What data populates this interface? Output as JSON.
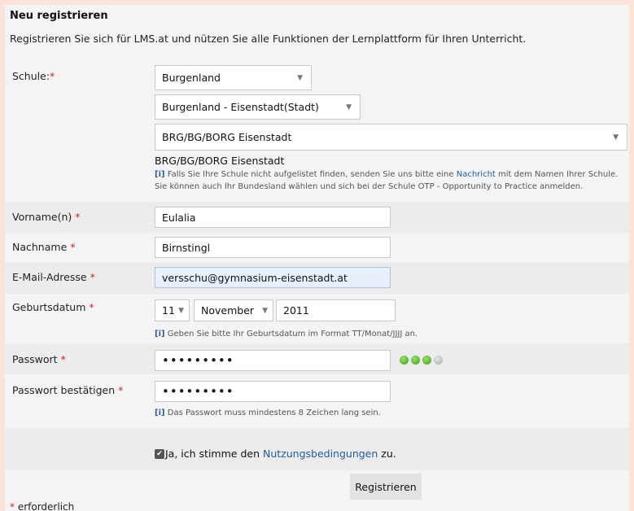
{
  "title": "Neu registrieren",
  "intro": "Registrieren Sie sich für LMS.at und nützen Sie alle Funktionen der Lernplattform für Ihren Unterricht.",
  "required_mark": "*",
  "school": {
    "label": "Schule:",
    "state": "Burgenland",
    "district": "Burgenland - Eisenstadt(Stadt)",
    "school": "BRG/BG/BORG Eisenstadt",
    "selected_text": "BRG/BG/BORG Eisenstadt",
    "hint_marker": "[i]",
    "hint_part1": "Falls Sie Ihre Schule nicht aufgelistet finden, senden Sie uns bitte eine",
    "hint_link": "Nachricht",
    "hint_part2": "mit dem Namen Ihrer Schule.",
    "hint_line2": "Sie können auch Ihr Bundesland wählen und sich bei der Schule OTP - Opportunity to Practice anmelden."
  },
  "firstname": {
    "label": "Vorname(n)",
    "value": "Eulalia"
  },
  "lastname": {
    "label": "Nachname",
    "value": "Birnstingl"
  },
  "email": {
    "label": "E-Mail-Adresse",
    "value": "versschu@gymnasium-eisenstadt.at"
  },
  "birthdate": {
    "label": "Geburtsdatum",
    "day": "11",
    "month": "November",
    "year": "2011",
    "hint": "Geben Sie bitte Ihr Geburtsdatum im Format TT/Monat/JJJJ an."
  },
  "password": {
    "label": "Passwort",
    "value": "•••••••••",
    "strength_filled": 3,
    "strength_total": 4
  },
  "password_confirm": {
    "label": "Passwort bestätigen",
    "value": "•••••••••",
    "hint": "Das Passwort muss mindestens 8 Zeichen lang sein."
  },
  "terms": {
    "prefix": "Ja, ich stimme den",
    "link": "Nutzungsbedingungen",
    "suffix": "zu.",
    "checked": true
  },
  "submit_label": "Registrieren",
  "footer": "erforderlich",
  "colors": {
    "required": "#cc2222",
    "link": "#1f5b9c",
    "strength_on": "#4caf28",
    "page_bg": "#fbe3da"
  }
}
